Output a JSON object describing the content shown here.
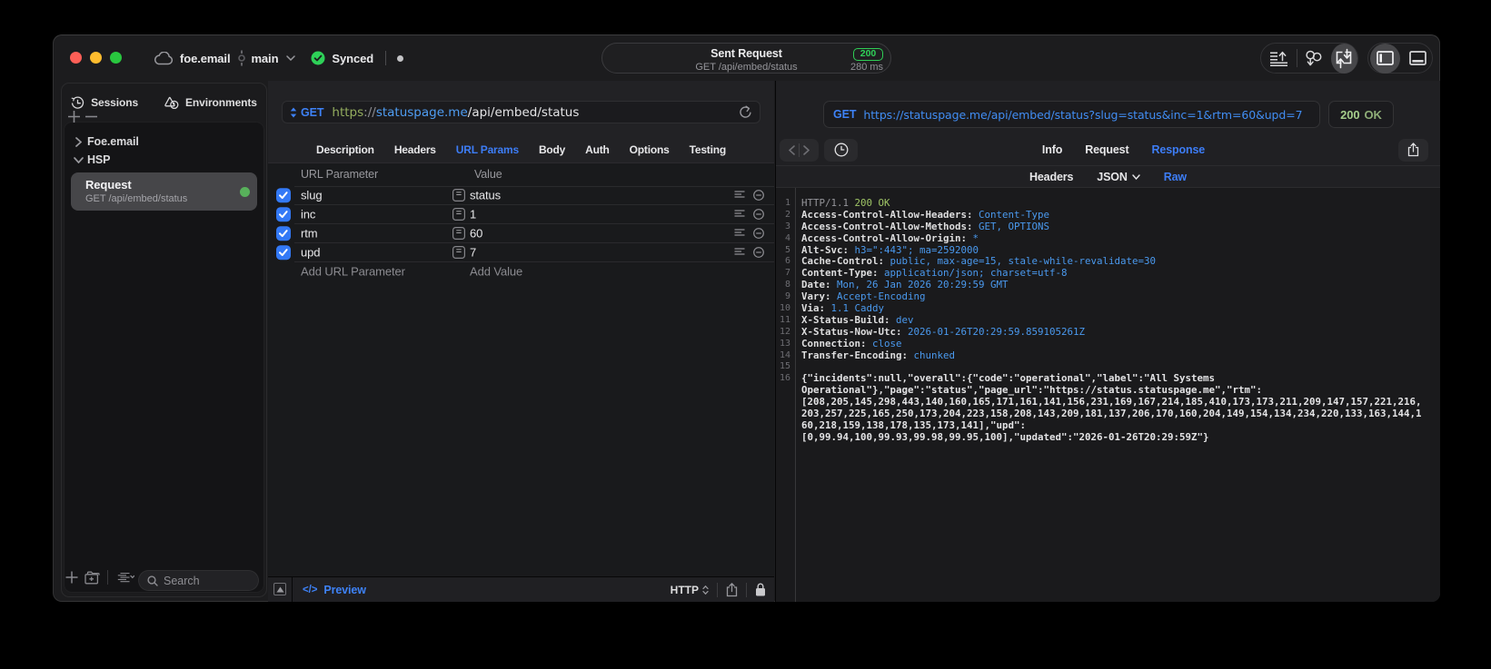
{
  "titlebar": {
    "project": "foe.email",
    "branch": "main",
    "sync_status": "Synced",
    "sent_request": {
      "title": "Sent Request",
      "subtitle": "GET /api/embed/status",
      "status_code": "200",
      "duration": "280 ms"
    }
  },
  "sidebar": {
    "tabs": [
      {
        "label": "Sessions"
      },
      {
        "label": "Environments"
      }
    ],
    "tree": [
      {
        "label": "Foe.email"
      },
      {
        "label": "HSP"
      }
    ],
    "request_item": {
      "title": "Request",
      "subtitle": "GET /api/embed/status"
    },
    "search_placeholder": "Search"
  },
  "request_panel": {
    "method": "GET",
    "url": {
      "scheme": "https",
      "sep": "://",
      "host": "statuspage.me",
      "path": "/api/embed/status"
    },
    "tabs": [
      {
        "label": "Description"
      },
      {
        "label": "Headers"
      },
      {
        "label": "URL Params"
      },
      {
        "label": "Body"
      },
      {
        "label": "Auth"
      },
      {
        "label": "Options"
      },
      {
        "label": "Testing"
      }
    ],
    "active_tab": "URL Params",
    "params": {
      "columns": {
        "name": "URL Parameter",
        "value": "Value"
      },
      "rows": [
        {
          "enabled": true,
          "name": "slug",
          "eq": "=",
          "value": "status"
        },
        {
          "enabled": true,
          "name": "inc",
          "eq": "=",
          "value": "1"
        },
        {
          "enabled": true,
          "name": "rtm",
          "eq": "=",
          "value": "60"
        },
        {
          "enabled": true,
          "name": "upd",
          "eq": "=",
          "value": "7"
        }
      ],
      "add_name_placeholder": "Add URL Parameter",
      "add_value_placeholder": "Add Value"
    },
    "footer": {
      "code_glyph": "</>",
      "preview_label": "Preview",
      "protocol": "HTTP"
    }
  },
  "response_panel": {
    "request_line": {
      "method": "GET",
      "url": "https://statuspage.me/api/embed/status?slug=status&inc=1&rtm=60&upd=7"
    },
    "status": {
      "code": "200",
      "text": "OK"
    },
    "tabs": [
      {
        "label": "Info"
      },
      {
        "label": "Request"
      },
      {
        "label": "Response"
      }
    ],
    "active_tab": "Response",
    "subtabs": [
      {
        "label": "Headers"
      },
      {
        "label": "JSON"
      },
      {
        "label": "Raw"
      }
    ],
    "active_subtab": "Raw",
    "raw": {
      "status_line": {
        "protocol": "HTTP/1.1",
        "status": "200 OK"
      },
      "headers": [
        {
          "num": "2",
          "name": "Access-Control-Allow-Headers",
          "value": "Content-Type"
        },
        {
          "num": "3",
          "name": "Access-Control-Allow-Methods",
          "value": "GET, OPTIONS"
        },
        {
          "num": "4",
          "name": "Access-Control-Allow-Origin",
          "value": "*"
        },
        {
          "num": "5",
          "name": "Alt-Svc",
          "value": "h3=\":443\"; ma=2592000"
        },
        {
          "num": "6",
          "name": "Cache-Control",
          "value": "public, max-age=15, stale-while-revalidate=30"
        },
        {
          "num": "7",
          "name": "Content-Type",
          "value": "application/json; charset=utf-8"
        },
        {
          "num": "8",
          "name": "Date",
          "value": "Mon, 26 Jan 2026 20:29:59 GMT"
        },
        {
          "num": "9",
          "name": "Vary",
          "value": "Accept-Encoding"
        },
        {
          "num": "10",
          "name": "Via",
          "value": "1.1 Caddy"
        },
        {
          "num": "11",
          "name": "X-Status-Build",
          "value": "dev"
        },
        {
          "num": "12",
          "name": "X-Status-Now-Utc",
          "value": "2026-01-26T20:29:59.859105261Z"
        },
        {
          "num": "13",
          "name": "Connection",
          "value": "close"
        },
        {
          "num": "14",
          "name": "Transfer-Encoding",
          "value": "chunked"
        }
      ],
      "body_line_num": "16",
      "body_lines": [
        "{\"incidents\":null,\"overall\":{\"code\":\"operational\",\"label\":\"All Systems",
        "Operational\"},\"page\":\"status\",\"page_url\":\"https://status.statuspage.me\",\"rtm\":",
        "[208,205,145,298,443,140,160,165,171,161,141,156,231,169,167,214,185,410,173,173,211,209,147,157,221,216,",
        "203,257,225,165,250,173,204,223,158,208,143,209,181,137,206,170,160,204,149,154,134,234,220,133,163,144,1",
        "60,218,159,138,178,135,173,141],\"upd\":",
        "[0,99.94,100,99.93,99.98,99.95,100],\"updated\":\"2026-01-26T20:29:59Z\"}"
      ]
    }
  }
}
